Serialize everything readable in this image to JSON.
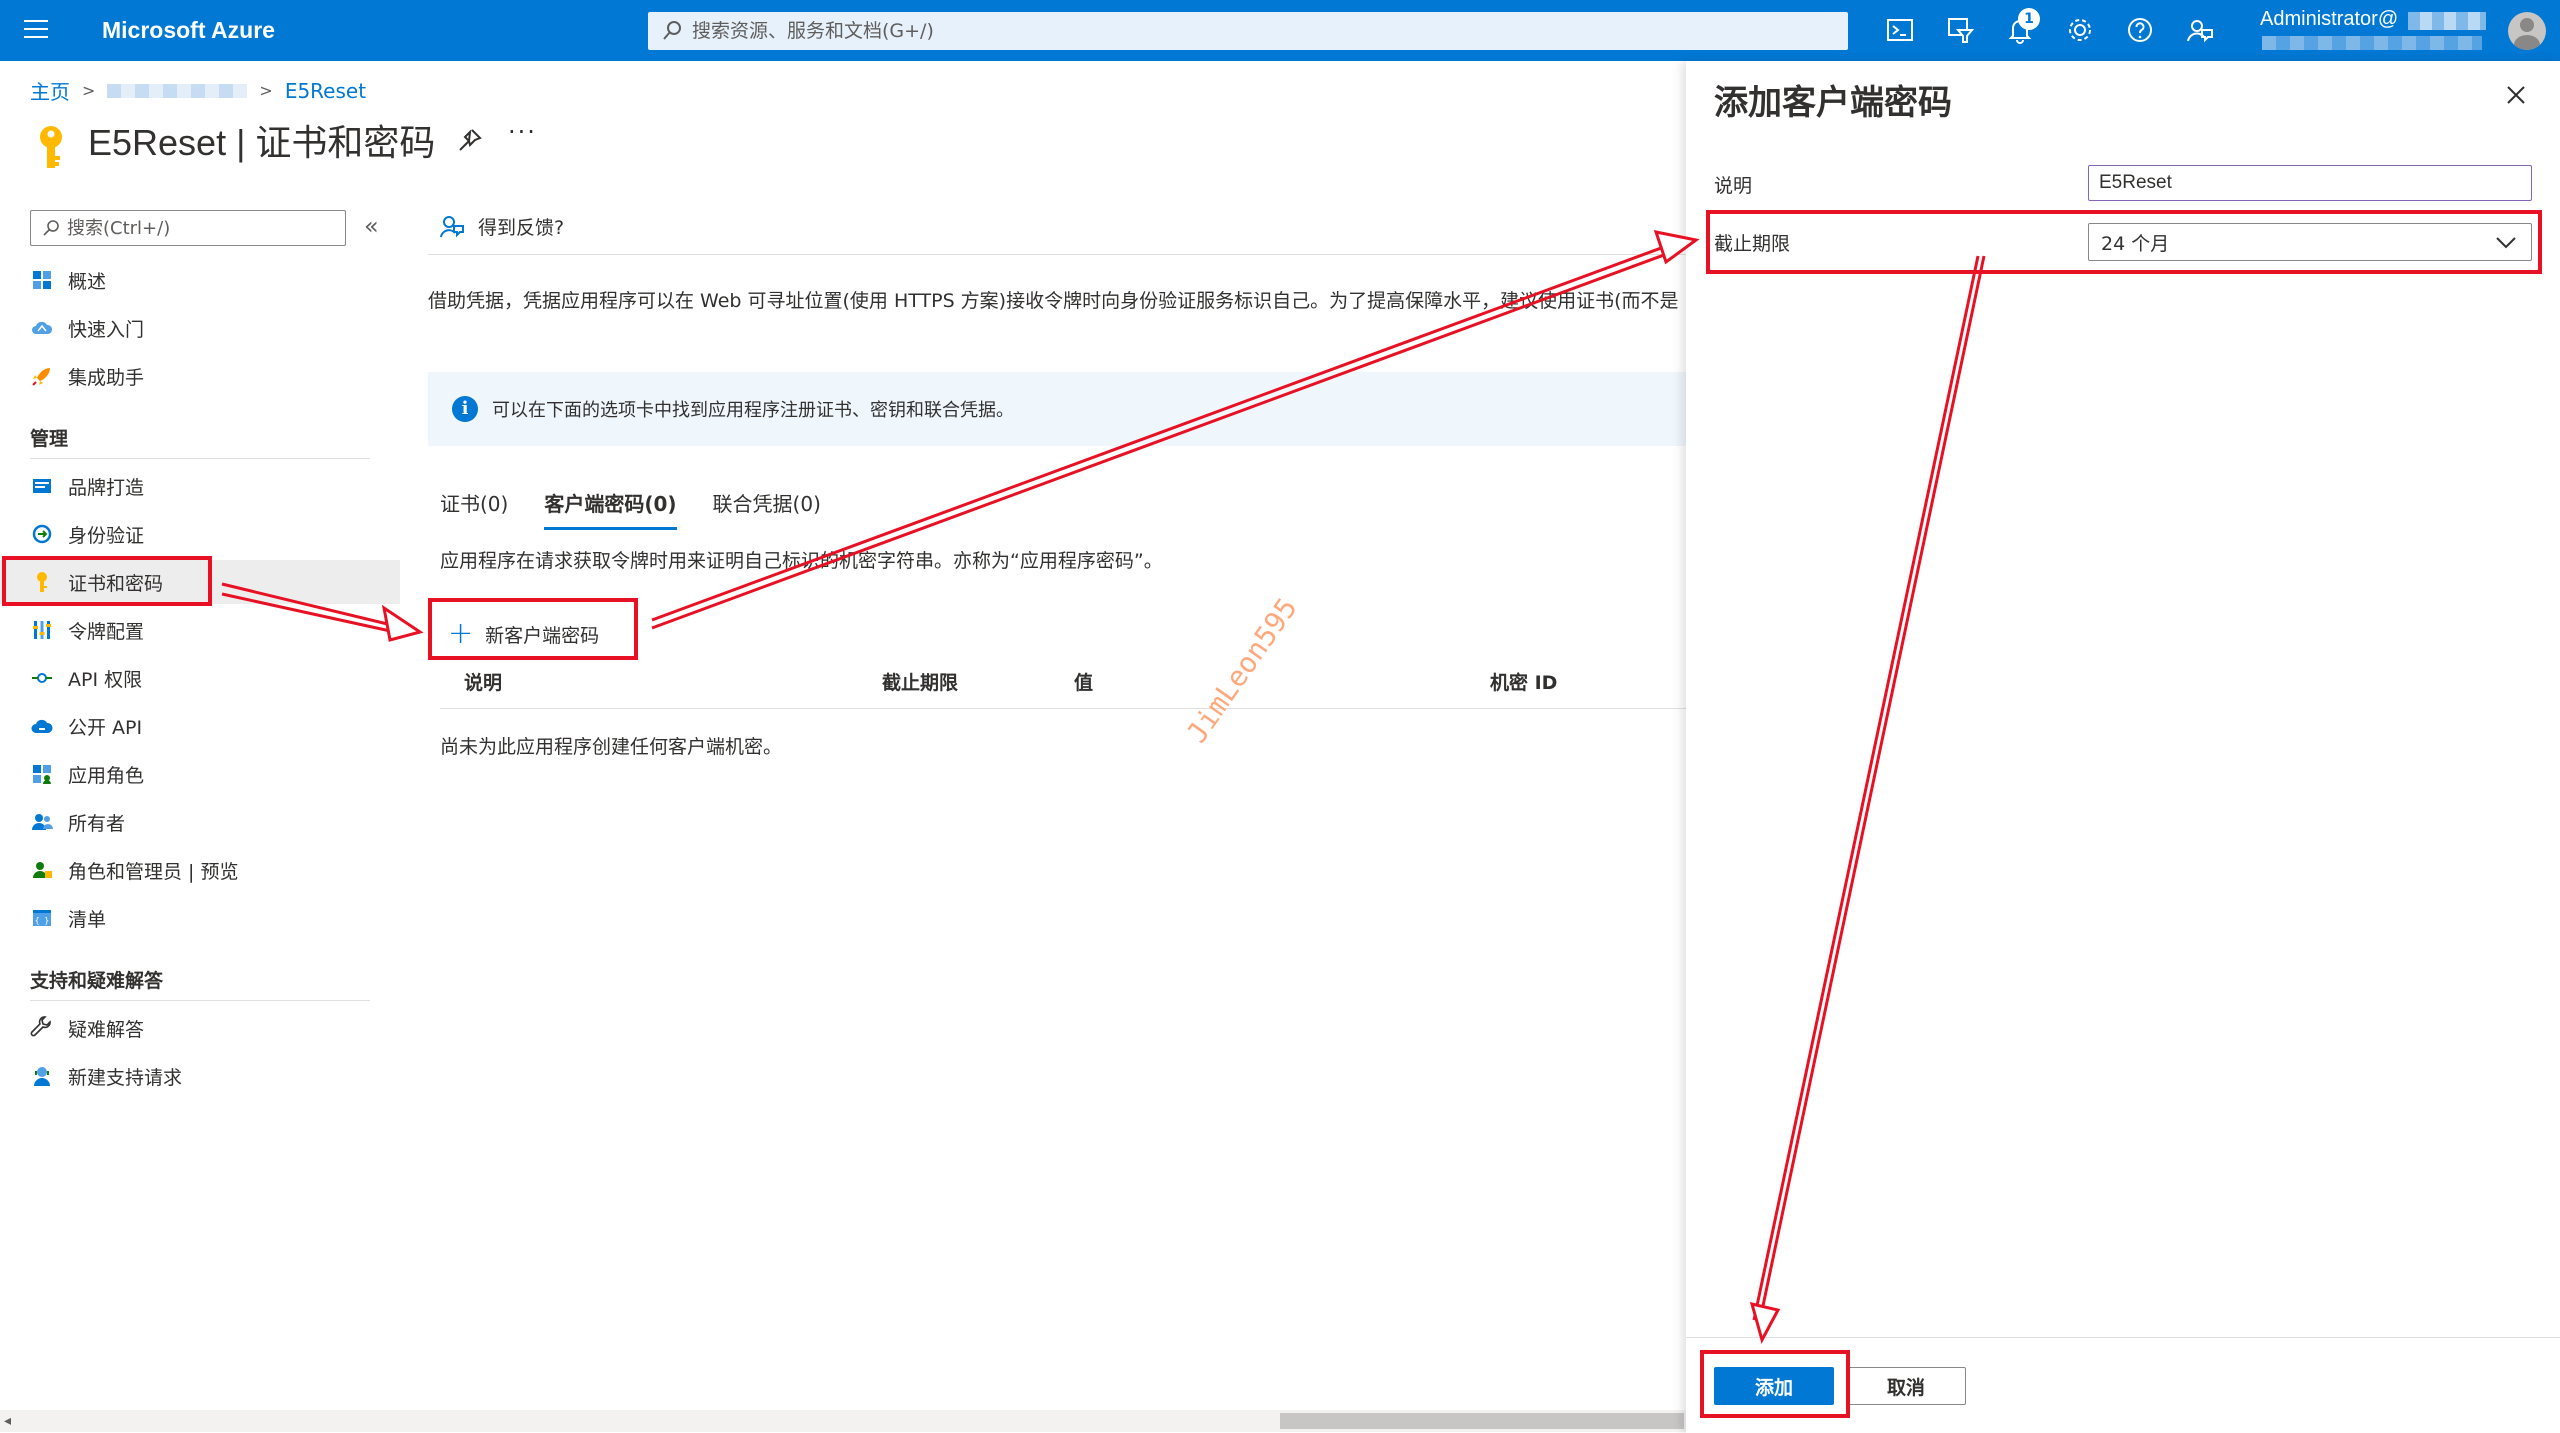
{
  "topbar": {
    "brand": "Microsoft Azure",
    "search_placeholder": "搜索资源、服务和文档(G+/)",
    "notification_count": "1",
    "account_name": "Administrator@",
    "icons": [
      "cloud-shell-icon",
      "directory-filter-icon",
      "notifications-icon",
      "settings-icon",
      "help-icon",
      "feedback-icon"
    ]
  },
  "breadcrumb": {
    "home": "主页",
    "current": "E5Reset"
  },
  "page": {
    "title": "E5Reset | 证书和密码"
  },
  "nav": {
    "search_placeholder": "搜索(Ctrl+/)",
    "items_top": [
      {
        "label": "概述",
        "icon": "overview-grid-icon"
      },
      {
        "label": "快速入门",
        "icon": "cloud-quickstart-icon"
      },
      {
        "label": "集成助手",
        "icon": "rocket-icon"
      }
    ],
    "section_manage": "管理",
    "items_manage": [
      {
        "label": "品牌打造",
        "icon": "branding-icon"
      },
      {
        "label": "身份验证",
        "icon": "authentication-icon"
      },
      {
        "label": "证书和密码",
        "icon": "key-icon"
      },
      {
        "label": "令牌配置",
        "icon": "token-config-icon"
      },
      {
        "label": "API 权限",
        "icon": "api-permissions-icon"
      },
      {
        "label": "公开 API",
        "icon": "expose-api-cloud-icon"
      },
      {
        "label": "应用角色",
        "icon": "app-roles-icon"
      },
      {
        "label": "所有者",
        "icon": "owners-icon"
      },
      {
        "label": "角色和管理员 | 预览",
        "icon": "roles-admins-icon"
      },
      {
        "label": "清单",
        "icon": "manifest-icon"
      }
    ],
    "section_support": "支持和疑难解答",
    "items_support": [
      {
        "label": "疑难解答",
        "icon": "wrench-icon"
      },
      {
        "label": "新建支持请求",
        "icon": "support-request-icon"
      }
    ]
  },
  "content": {
    "feedback": "得到反馈?",
    "description": "借助凭据，凭据应用程序可以在 Web 可寻址位置(使用 HTTPS 方案)接收令牌时向身份验证服务标识自己。为了提高保障水平，建议使用证书(而不是",
    "info": "可以在下面的选项卡中找到应用程序注册证书、密钥和联合凭据。",
    "tabs": [
      "证书(0)",
      "客户端密码(0)",
      "联合凭据(0)"
    ],
    "tab_description": "应用程序在请求获取令牌时用来证明自己标识的机密字符串。亦称为“应用程序密码”。",
    "new_secret_button": "新客户端密码",
    "table_headers": [
      "说明",
      "截止期限",
      "值",
      "机密 ID"
    ],
    "empty_message": "尚未为此应用程序创建任何客户端机密。",
    "watermark": "JimLeon595"
  },
  "panel": {
    "title": "添加客户端密码",
    "description_label": "说明",
    "description_value": "E5Reset",
    "expires_label": "截止期限",
    "expires_value": "24 个月",
    "add_button": "添加",
    "cancel_button": "取消"
  },
  "colors": {
    "azure_blue": "#0078d4",
    "annotation_red": "#e81123"
  }
}
